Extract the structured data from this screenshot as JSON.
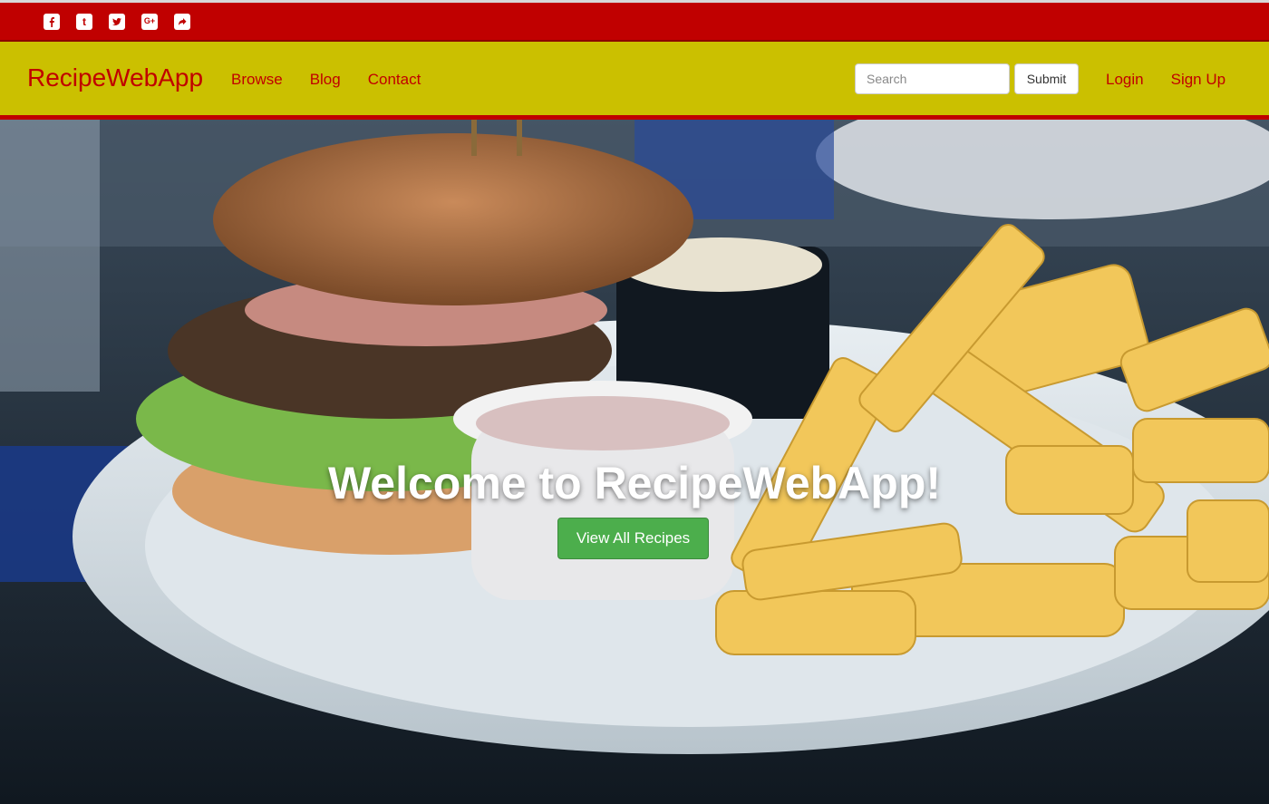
{
  "social": {
    "icons": [
      "facebook-icon",
      "tumblr-icon",
      "twitter-icon",
      "google-plus-icon",
      "share-icon"
    ],
    "tumblr_glyph": "t",
    "google_glyph": "G+"
  },
  "navbar": {
    "brand": "RecipeWebApp",
    "links": [
      {
        "label": "Browse"
      },
      {
        "label": "Blog"
      },
      {
        "label": "Contact"
      }
    ],
    "search_placeholder": "Search",
    "submit_label": "Submit",
    "login_label": "Login",
    "signup_label": "Sign Up"
  },
  "hero": {
    "title": "Welcome to RecipeWebApp!",
    "button_label": "View All Recipes"
  },
  "colors": {
    "social_bar": "#c00000",
    "navbar": "#cbc000",
    "link": "#c00000",
    "cta": "#4cae4c"
  }
}
